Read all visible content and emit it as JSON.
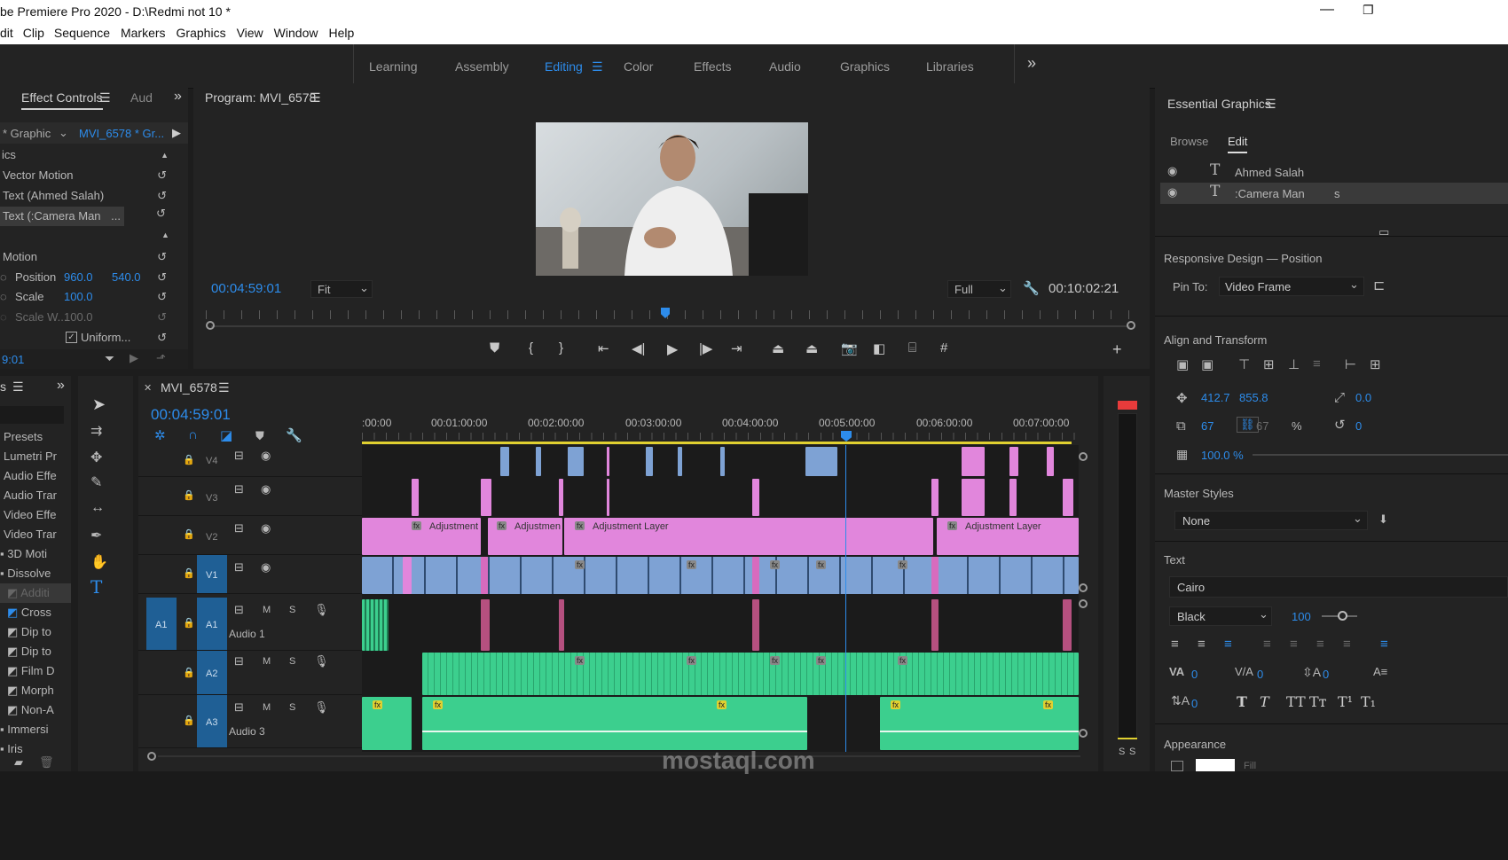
{
  "app": {
    "title": "be Premiere Pro 2020 - D:\\Redmi not 10 *"
  },
  "menu": [
    "dit",
    "Clip",
    "Sequence",
    "Markers",
    "Graphics",
    "View",
    "Window",
    "Help"
  ],
  "workspaces": [
    {
      "label": "Learning",
      "active": false
    },
    {
      "label": "Assembly",
      "active": false
    },
    {
      "label": "Editing",
      "active": true
    },
    {
      "label": "Color",
      "active": false
    },
    {
      "label": "Effects",
      "active": false
    },
    {
      "label": "Audio",
      "active": false
    },
    {
      "label": "Graphics",
      "active": false
    },
    {
      "label": "Libraries",
      "active": false
    }
  ],
  "effect_controls": {
    "tab_label": "Effect Controls",
    "tab2_label": "Aud",
    "source": "* Graphic",
    "clip": "MVI_6578 * Gr...",
    "section": "ics",
    "items": [
      "Vector Motion",
      "Text (Ahmed Salah)",
      "Text (:Camera Man"
    ],
    "motion_label": "Motion",
    "position_label": "Position",
    "position_x": "960.0",
    "position_y": "540.0",
    "scale_label": "Scale",
    "scale_value": "100.0",
    "scale_w_label": "Scale W...",
    "scale_w_value": "100.0",
    "uniform_label": "Uniform...",
    "timecode": "9:01"
  },
  "program": {
    "title": "Program: MVI_6578",
    "timecode": "00:04:59:01",
    "fit": "Fit",
    "quality": "Full",
    "duration": "00:10:02:21"
  },
  "effects_panel": {
    "tab": "s",
    "items": [
      "Presets",
      "Lumetri Pr",
      "Audio Effe",
      "Audio Trar",
      "Video Effe",
      "Video Trar",
      "3D Moti",
      "Dissolve",
      "Additi",
      "Cross",
      "Dip to",
      "Dip to",
      "Film D",
      "Morph",
      "Non-A",
      "Immersi",
      "Iris"
    ]
  },
  "timeline": {
    "sequence": "MVI_6578",
    "timecode": "00:04:59:01",
    "ruler": [
      ":00:00",
      "00:01:00:00",
      "00:02:00:00",
      "00:03:00:00",
      "00:04:00:00",
      "00:05:00:00",
      "00:06:00:00",
      "00:07:00:00"
    ],
    "tracks": [
      {
        "name": "V4"
      },
      {
        "name": "V3"
      },
      {
        "name": "V2"
      },
      {
        "name": "V1"
      },
      {
        "name": "A1",
        "label": "Audio 1"
      },
      {
        "name": "A2",
        "label": ""
      },
      {
        "name": "A3",
        "label": "Audio 3"
      }
    ],
    "adjustment_labels": [
      "Adjustment",
      "Adjustmen",
      "Adjustment Layer",
      "Adjustment Layer"
    ],
    "fx": "fx",
    "m": "M",
    "s": "S",
    "meter_labels": [
      "S",
      "S"
    ]
  },
  "essential_graphics": {
    "title": "Essential Graphics",
    "tab_browse": "Browse",
    "tab_edit": "Edit",
    "layers": [
      "Ahmed Salah",
      ":Camera Man"
    ],
    "layer_suffix": "s",
    "responsive_title": "Responsive Design — Position",
    "pin_to_label": "Pin To:",
    "pin_to_value": "Video Frame",
    "align_title": "Align and Transform",
    "pos_x": "412.7",
    "pos_y": "855.8",
    "rot": "0.0",
    "scale_w": "67",
    "scale_h": "67",
    "pct": "%",
    "rotate": "0",
    "opacity": "100.0 %",
    "master_styles_title": "Master Styles",
    "master_styles_value": "None",
    "text_title": "Text",
    "font": "Cairo",
    "weight": "Black",
    "size": "100",
    "tracking": "0",
    "kerning": "0",
    "leading": "0",
    "baseline": "0",
    "appearance_title": "Appearance",
    "fill": "Fill"
  },
  "watermark": "mostaql.com",
  "colors": {
    "accent": "#2d8ceb",
    "adjustment": "#e186dc",
    "video": "#7ea2d4",
    "audio": "#3ccf8e",
    "playhead": "#2d8ceb"
  }
}
